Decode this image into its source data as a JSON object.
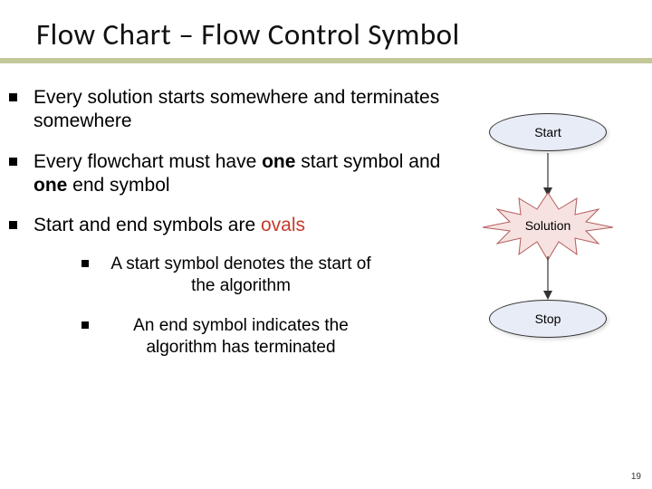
{
  "title": "Flow  Chart – Flow Control Symbol",
  "bullets": [
    {
      "pre": "Every solution starts somewhere and terminates somewhere"
    },
    {
      "pre": "Every flowchart must have ",
      "bold1": "one",
      "mid": " start symbol and ",
      "bold2": "one ",
      "post": "end symbol"
    },
    {
      "pre": "Start and end symbols are ",
      "red": "ovals"
    }
  ],
  "subs": [
    "A start symbol denotes the start of the algorithm",
    "An end symbol indicates the algorithm has terminated"
  ],
  "diagram": {
    "start": "Start",
    "solution": "Solution",
    "stop": "Stop"
  },
  "page": "19"
}
